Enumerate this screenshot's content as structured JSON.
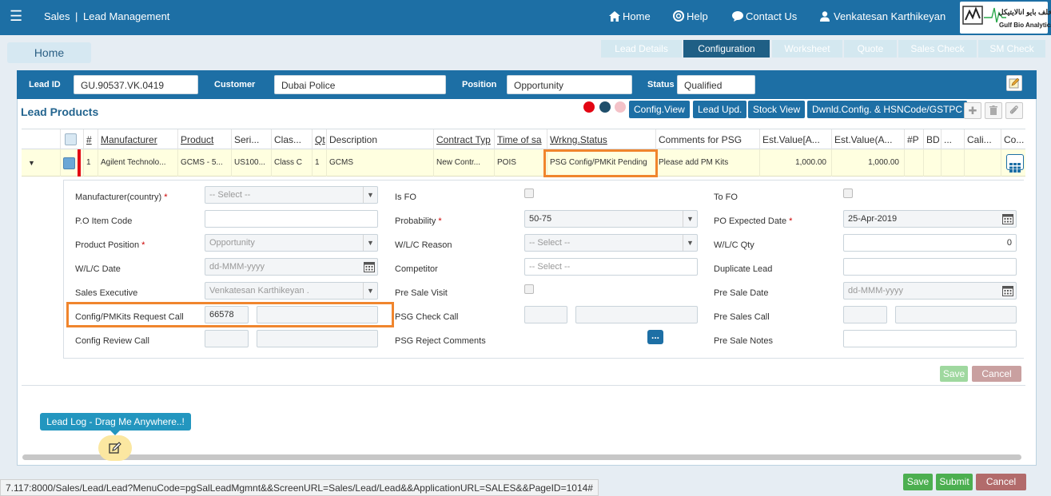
{
  "header": {
    "app": "Sales",
    "separator": "|",
    "module": "Lead Management",
    "home": "Home",
    "help": "Help",
    "contact": "Contact Us",
    "user": "Venkatesan Karthikeyan",
    "logo_name": "Gulf Bio Analytical",
    "logo_arabic": "خلف بايو انالايتيكل"
  },
  "nav": {
    "home_button": "Home",
    "tabs": [
      "Lead Details",
      "Configuration",
      "Worksheet",
      "Quote",
      "Sales Check",
      "SM Check"
    ],
    "active_tab": "Configuration"
  },
  "lead": {
    "lead_id_label": "Lead ID",
    "lead_id": "GU.90537.VK.0419",
    "customer_label": "Customer",
    "customer": "Dubai Police",
    "position_label": "Position",
    "position": "Opportunity",
    "status_label": "Status",
    "status": "Qualified"
  },
  "products": {
    "title": "Lead Products",
    "dots": [
      "#e30613",
      "#1f4e6b",
      "#f4c2c8"
    ],
    "buttons": [
      "Config.View",
      "Lead Upd.",
      "Stock View",
      "Dwnld.Config. & HSNCode/GSTPC"
    ],
    "icons": [
      "plus-icon",
      "trash-icon",
      "paperclip-icon"
    ],
    "columns": [
      "#",
      "Manufacturer",
      "Product",
      "Seri...",
      "Clas...",
      "Qt",
      "Description",
      "Contract Typ",
      "Time of sa",
      "Wrkng.Status",
      "Comments for PSG",
      "Est.Value[A...",
      "Est.Value(A...",
      "#P",
      "BD",
      "...",
      "Cali...",
      "Co..."
    ],
    "row": {
      "num": "1",
      "manufacturer": "Agilent Technolo...",
      "product": "GCMS - 5...",
      "serial": "US100...",
      "class": "Class C",
      "qty": "1",
      "description": "GCMS",
      "contract": "New Contr...",
      "time_of_sale": "POIS",
      "status": "PSG Config/PMKit Pending",
      "comments": "Please add PM Kits",
      "est_value_a": "1,000.00",
      "est_value_b": "1,000.00"
    }
  },
  "form": {
    "manufacturer_label": "Manufacturer(country)",
    "manufacturer_value": "-- Select --",
    "is_fo_label": "Is FO",
    "to_fo_label": "To FO",
    "po_item_code_label": "P.O Item Code",
    "po_item_code": "",
    "probability_label": "Probability",
    "probability": "50-75",
    "po_expected_date_label": "PO Expected Date",
    "po_expected_date": "25-Apr-2019",
    "product_position_label": "Product Position",
    "product_position": "Opportunity",
    "wlc_reason_label": "W/L/C Reason",
    "wlc_reason": "-- Select --",
    "wlc_qty_label": "W/L/C Qty",
    "wlc_qty": "0",
    "wlc_date_label": "W/L/C Date",
    "wlc_date_placeholder": "dd-MMM-yyyy",
    "competitor_label": "Competitor",
    "competitor_placeholder": "-- Select --",
    "duplicate_lead_label": "Duplicate Lead",
    "sales_exec_label": "Sales Executive",
    "sales_exec": "Venkatesan Karthikeyan .",
    "pre_sale_visit_label": "Pre Sale Visit",
    "pre_sale_date_label": "Pre Sale Date",
    "pre_sale_date_placeholder": "dd-MMM-yyyy",
    "config_request_label": "Config/PMKits Request Call",
    "config_request_value": "66578",
    "psg_check_label": "PSG Check Call",
    "pre_sales_call_label": "Pre Sales Call",
    "config_review_label": "Config Review Call",
    "psg_reject_label": "PSG Reject Comments",
    "ellipsis_label": "...",
    "pre_sale_notes_label": "Pre Sale Notes",
    "save": "Save",
    "cancel": "Cancel"
  },
  "footer": {
    "lead_log": "Lead Log - Drag Me Anywhere..!",
    "save": "Save",
    "submit": "Submit",
    "cancel": "Cancel",
    "status_url": "7.117:8000/Sales/Lead/Lead?MenuCode=pgSalLeadMgmnt&&ScreenURL=Sales/Lead/Lead&&ApplicationURL=SALES&&PageID=1014#"
  }
}
